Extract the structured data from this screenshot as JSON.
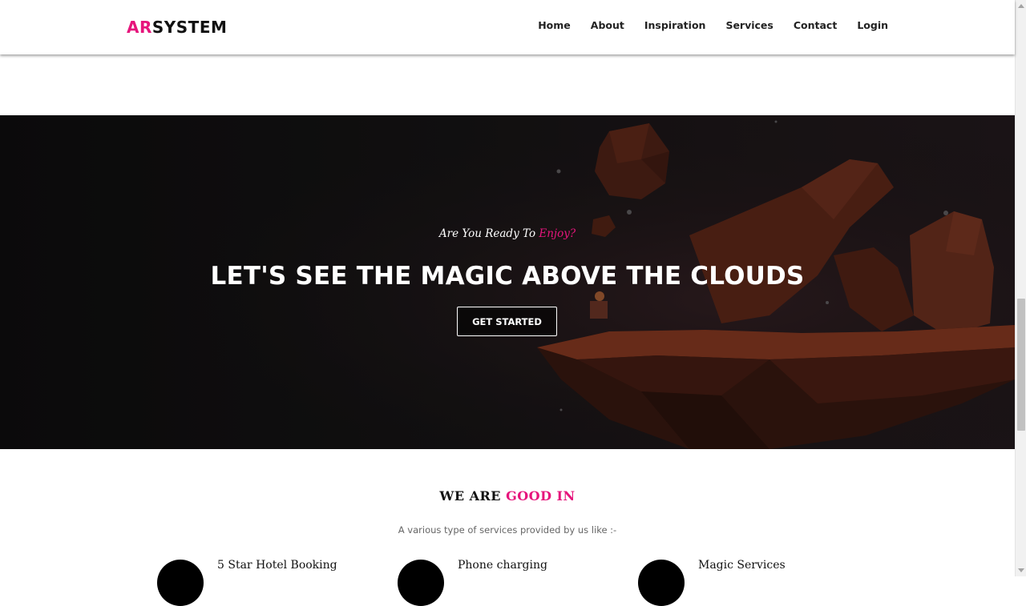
{
  "brand": {
    "logo_accent": "AR",
    "logo_rest": "SYSTEM",
    "accent_color": "#e6157c"
  },
  "nav": {
    "items": [
      {
        "label": "Home"
      },
      {
        "label": "About"
      },
      {
        "label": "Inspiration"
      },
      {
        "label": "Services"
      },
      {
        "label": "Contact"
      },
      {
        "label": "Login"
      }
    ]
  },
  "hero": {
    "subtitle_prefix": "Are You Ready To ",
    "subtitle_accent": "Enjoy?",
    "title": "LET'S SEE THE MAGIC ABOVE THE CLOUDS",
    "button_label": "GET STARTED"
  },
  "services": {
    "title_prefix": "WE ARE ",
    "title_accent": "GOOD IN",
    "subtitle": "A various type of services provided by us like :-",
    "items": [
      {
        "label": "5 Star Hotel Booking",
        "icon": "circle-icon"
      },
      {
        "label": "Phone charging",
        "icon": "circle-icon"
      },
      {
        "label": "Magic Services",
        "icon": "circle-icon"
      }
    ]
  }
}
